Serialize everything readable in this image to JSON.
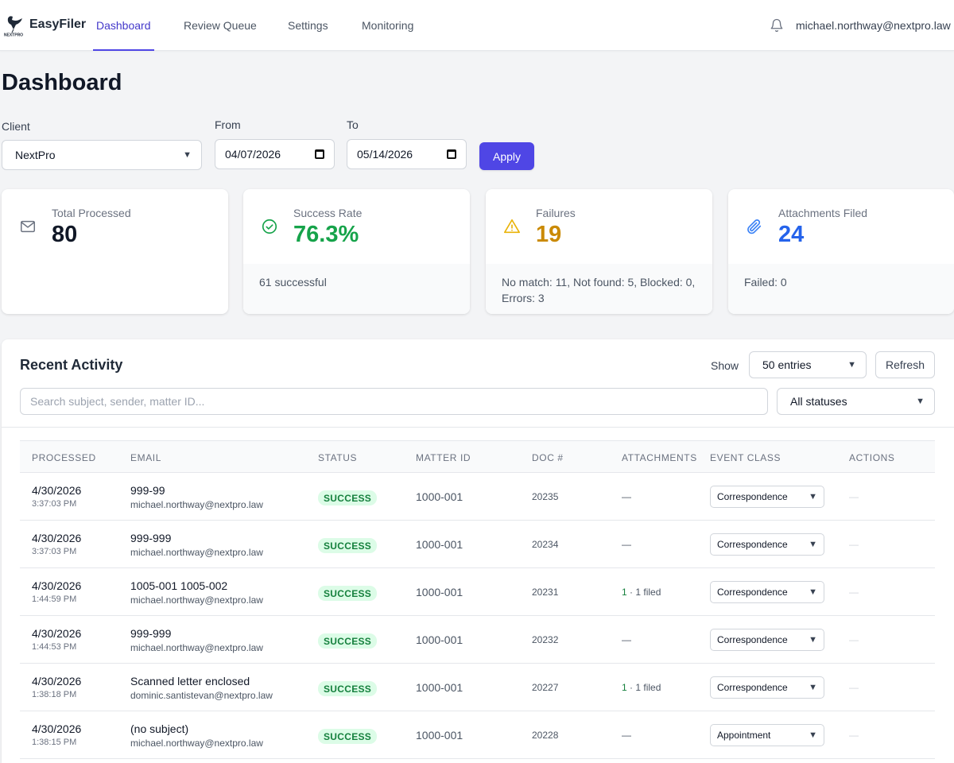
{
  "nav": {
    "brand": "EasyFiler",
    "logo_text": "NEXTPRO",
    "tabs": [
      {
        "label": "Dashboard"
      },
      {
        "label": "Review Queue"
      },
      {
        "label": "Settings"
      },
      {
        "label": "Monitoring"
      }
    ],
    "active_tab": "Dashboard",
    "user_email": "michael.northway@nextpro.law"
  },
  "page": {
    "title": "Dashboard"
  },
  "filters": {
    "client_label": "Client",
    "client_value": "NextPro",
    "from_label": "From",
    "from_value": "04/07/2026",
    "to_label": "To",
    "to_value": "05/14/2026",
    "apply_label": "Apply"
  },
  "stats": [
    {
      "label": "Total Processed",
      "value": "80",
      "footer": "",
      "icon": "envelope-icon",
      "color": "#111827"
    },
    {
      "label": "Success Rate",
      "value": "76.3%",
      "footer": "61 successful",
      "icon": "check-circle-icon",
      "color": "#16a34a"
    },
    {
      "label": "Failures",
      "value": "19",
      "footer": "No match: 11, Not found: 5, Blocked: 0, Errors: 3",
      "icon": "warning-icon",
      "color": "#ca8a04"
    },
    {
      "label": "Attachments Filed",
      "value": "24",
      "footer": "Failed: 0",
      "icon": "paperclip-icon",
      "color": "#2563eb"
    }
  ],
  "activity": {
    "title": "Recent Activity",
    "show_label": "Show",
    "entries_value": "50 entries",
    "refresh_label": "Refresh",
    "search_placeholder": "Search subject, sender, matter ID...",
    "status_filter": "All statuses",
    "columns": [
      "PROCESSED",
      "EMAIL",
      "STATUS",
      "MATTER ID",
      "DOC #",
      "ATTACHMENTS",
      "EVENT CLASS",
      "ACTIONS"
    ],
    "rows": [
      {
        "date": "4/30/2026",
        "time": "3:37:03 PM",
        "subject": "999-99",
        "sender": "michael.northway@nextpro.law",
        "status": "SUCCESS",
        "matter": "1000-001",
        "doc": "20235",
        "att_count": "",
        "att_text": "—",
        "event_class": "Correspondence",
        "actions": "—"
      },
      {
        "date": "4/30/2026",
        "time": "3:37:03 PM",
        "subject": "999-999",
        "sender": "michael.northway@nextpro.law",
        "status": "SUCCESS",
        "matter": "1000-001",
        "doc": "20234",
        "att_count": "",
        "att_text": "—",
        "event_class": "Correspondence",
        "actions": "—"
      },
      {
        "date": "4/30/2026",
        "time": "1:44:59 PM",
        "subject": "1005-001 1005-002",
        "sender": "michael.northway@nextpro.law",
        "status": "SUCCESS",
        "matter": "1000-001",
        "doc": "20231",
        "att_count": "1",
        "att_text": " · 1 filed",
        "event_class": "Correspondence",
        "actions": "—"
      },
      {
        "date": "4/30/2026",
        "time": "1:44:53 PM",
        "subject": "999-999",
        "sender": "michael.northway@nextpro.law",
        "status": "SUCCESS",
        "matter": "1000-001",
        "doc": "20232",
        "att_count": "",
        "att_text": "—",
        "event_class": "Correspondence",
        "actions": "—"
      },
      {
        "date": "4/30/2026",
        "time": "1:38:18 PM",
        "subject": "Scanned letter enclosed",
        "sender": "dominic.santistevan@nextpro.law",
        "status": "SUCCESS",
        "matter": "1000-001",
        "doc": "20227",
        "att_count": "1",
        "att_text": " · 1 filed",
        "event_class": "Correspondence",
        "actions": "—"
      },
      {
        "date": "4/30/2026",
        "time": "1:38:15 PM",
        "subject": "(no subject)",
        "sender": "michael.northway@nextpro.law",
        "status": "SUCCESS",
        "matter": "1000-001",
        "doc": "20228",
        "att_count": "",
        "att_text": "—",
        "event_class": "Appointment",
        "actions": "—"
      }
    ]
  }
}
